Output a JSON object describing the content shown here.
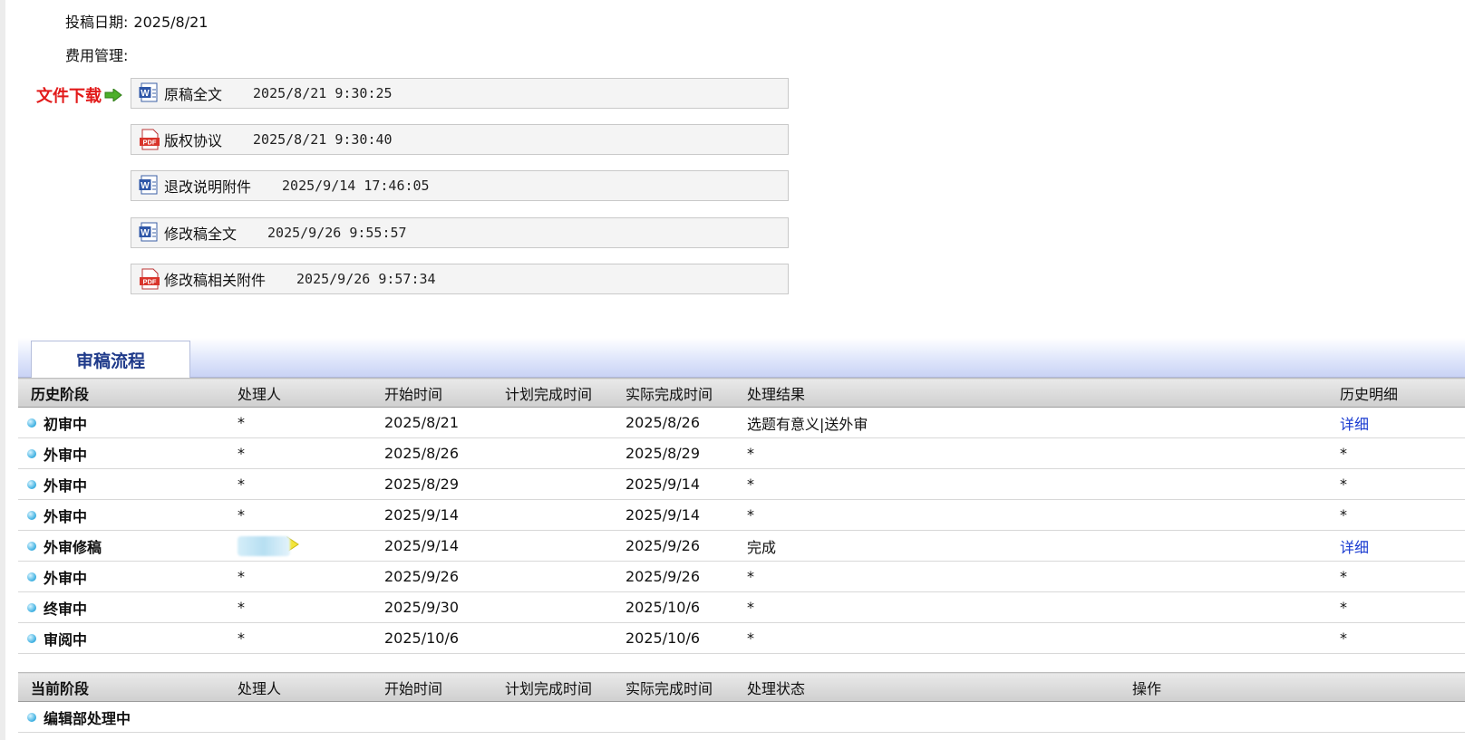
{
  "submission": {
    "date_label": "投稿日期:",
    "date_value": "2025/8/21",
    "fee_label": "费用管理:"
  },
  "downloads": {
    "label": "文件下载",
    "arrow_icon": "green-arrow-right-icon",
    "files": [
      {
        "icon": "word-doc-icon",
        "name": "原稿全文",
        "time": "2025/8/21 9:30:25"
      },
      {
        "icon": "pdf-icon",
        "name": "版权协议",
        "time": "2025/8/21 9:30:40"
      },
      {
        "icon": "word-doc-icon",
        "name": "退改说明附件",
        "time": "2025/9/14 17:46:05"
      },
      {
        "icon": "word-doc-icon",
        "name": "修改稿全文",
        "time": "2025/9/26 9:55:57"
      },
      {
        "icon": "pdf-icon",
        "name": "修改稿相关附件",
        "time": "2025/9/26 9:57:34"
      }
    ]
  },
  "review_section": {
    "tab_title": "审稿流程"
  },
  "history": {
    "headers": [
      "历史阶段",
      "处理人",
      "开始时间",
      "计划完成时间",
      "实际完成时间",
      "处理结果",
      "历史明细"
    ],
    "rows": [
      {
        "stage": "初审中",
        "handler": "*",
        "start": "2025/8/21",
        "planned": "",
        "actual": "2025/8/26",
        "result": "选题有意义|送外审",
        "detail": "详细"
      },
      {
        "stage": "外审中",
        "handler": "*",
        "start": "2025/8/26",
        "planned": "",
        "actual": "2025/8/29",
        "result": "*",
        "detail": "*"
      },
      {
        "stage": "外审中",
        "handler": "*",
        "start": "2025/8/29",
        "planned": "",
        "actual": "2025/9/14",
        "result": "*",
        "detail": "*"
      },
      {
        "stage": "外审中",
        "handler": "*",
        "start": "2025/9/14",
        "planned": "",
        "actual": "2025/9/14",
        "result": "*",
        "detail": "*"
      },
      {
        "stage": "外审修稿",
        "handler": "",
        "start": "2025/9/14",
        "planned": "",
        "actual": "2025/9/26",
        "result": "完成",
        "detail": "详细"
      },
      {
        "stage": "外审中",
        "handler": "*",
        "start": "2025/9/26",
        "planned": "",
        "actual": "2025/9/26",
        "result": "*",
        "detail": "*"
      },
      {
        "stage": "终审中",
        "handler": "*",
        "start": "2025/9/30",
        "planned": "",
        "actual": "2025/10/6",
        "result": "*",
        "detail": "*"
      },
      {
        "stage": "审阅中",
        "handler": "*",
        "start": "2025/10/6",
        "planned": "",
        "actual": "2025/10/6",
        "result": "*",
        "detail": "*"
      }
    ]
  },
  "current": {
    "headers": [
      "当前阶段",
      "处理人",
      "开始时间",
      "计划完成时间",
      "实际完成时间",
      "处理状态",
      "操作"
    ],
    "rows": [
      {
        "stage": "编辑部处理中"
      }
    ]
  },
  "colors": {
    "download_label": "#e21a1a",
    "link": "#1a3bd1",
    "tab_title": "#1f3a8a"
  }
}
